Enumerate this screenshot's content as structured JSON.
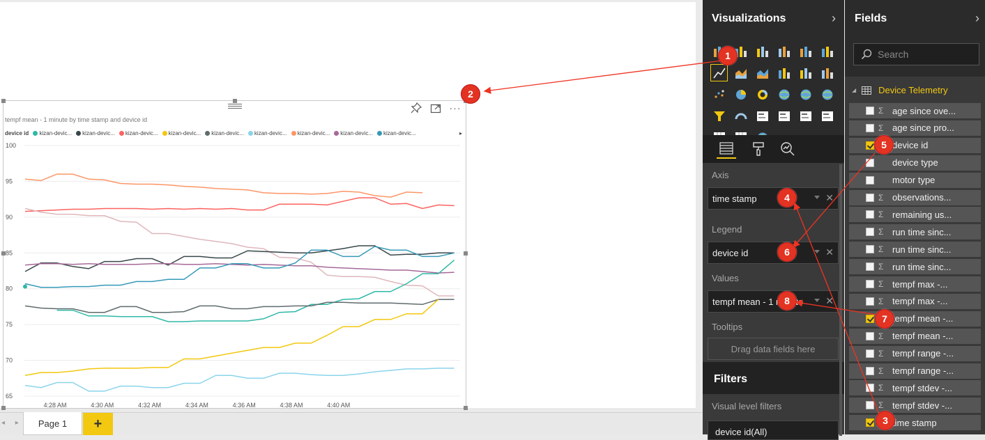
{
  "chart": {
    "title": "tempf mean - 1 minute by time stamp and device id",
    "legend_title": "device id",
    "legend_items": [
      {
        "label": "kizan-devic...",
        "color": "#2fb8a7"
      },
      {
        "label": "kizan-devic...",
        "color": "#374649"
      },
      {
        "label": "kizan-devic...",
        "color": "#fd625e"
      },
      {
        "label": "kizan-devic...",
        "color": "#f2c80f"
      },
      {
        "label": "kizan-devic...",
        "color": "#5f6b6d"
      },
      {
        "label": "kizan-devic...",
        "color": "#8ad4eb"
      },
      {
        "label": "kizan-devic...",
        "color": "#fe9666"
      },
      {
        "label": "kizan-devic...",
        "color": "#a66999"
      },
      {
        "label": "kizan-devic...",
        "color": "#3599b8"
      }
    ],
    "legend_more": "▸"
  },
  "chart_data": {
    "type": "line",
    "title": "tempf mean - 1 minute by time stamp and device id",
    "xlabel": "",
    "ylabel": "",
    "x_ticks": [
      "4:28 AM",
      "4:30 AM",
      "4:32 AM",
      "4:34 AM",
      "4:36 AM",
      "4:38 AM",
      "4:40 AM"
    ],
    "ylim": [
      65,
      100
    ],
    "y_ticks": [
      65,
      70,
      75,
      80,
      85,
      90,
      95,
      100
    ],
    "grid": true,
    "series": [
      {
        "color": "#fe9666",
        "values": [
          95.3,
          95.1,
          96.0,
          96.0,
          95.3,
          95.2,
          94.7,
          94.6,
          94.6,
          94.5,
          94.3,
          94.2,
          94.0,
          93.9,
          93.8,
          93.4,
          93.3,
          93.3,
          93.2,
          93.3,
          93.6,
          93.5,
          93.0,
          92.8,
          93.5,
          93.4,
          null,
          null
        ]
      },
      {
        "color": "#fd625e",
        "values": [
          90.8,
          90.9,
          91.0,
          91.1,
          91.1,
          91.2,
          91.2,
          91.2,
          91.1,
          91.2,
          91.1,
          91.2,
          91.1,
          91.2,
          91.0,
          91.0,
          91.8,
          91.8,
          91.8,
          91.7,
          92.2,
          92.7,
          92.7,
          91.8,
          91.9,
          91.2,
          91.7,
          91.6
        ]
      },
      {
        "color": "#dfb7bc",
        "values": [
          91.2,
          90.7,
          90.4,
          90.4,
          90.2,
          90.2,
          89.4,
          89.3,
          87.7,
          87.7,
          87.3,
          86.9,
          86.6,
          86.3,
          85.8,
          85.6,
          84.4,
          84.3,
          83.7,
          81.9,
          81.7,
          81.7,
          81.6,
          81.0,
          80.5,
          80.4,
          79.0,
          79.0
        ]
      },
      {
        "color": "#374649",
        "values": [
          82.4,
          83.6,
          83.6,
          83.1,
          82.8,
          83.8,
          83.8,
          84.2,
          84.2,
          83.3,
          84.5,
          84.5,
          84.3,
          84.3,
          85.3,
          85.2,
          85.1,
          85.0,
          85.0,
          85.3,
          85.6,
          86.0,
          86.0,
          84.7,
          84.8,
          84.8,
          85.0,
          85.0
        ]
      },
      {
        "color": "#a66999",
        "values": [
          83.3,
          83.5,
          83.5,
          83.4,
          83.5,
          83.4,
          83.4,
          83.4,
          83.5,
          83.5,
          83.4,
          83.4,
          83.5,
          83.4,
          83.3,
          83.4,
          83.3,
          83.2,
          83.2,
          83.0,
          82.9,
          82.8,
          82.7,
          82.6,
          82.6,
          82.4,
          82.2,
          82.3
        ]
      },
      {
        "color": "#3599b8",
        "values": [
          80.7,
          80.2,
          80.2,
          80.3,
          80.3,
          80.5,
          80.5,
          81.0,
          81.0,
          81.3,
          81.3,
          82.9,
          82.9,
          83.5,
          83.5,
          82.9,
          82.9,
          83.6,
          85.4,
          85.4,
          84.5,
          84.5,
          85.9,
          85.4,
          85.4,
          84.5,
          84.5,
          85.0
        ]
      },
      {
        "color": "#2fb8a7",
        "values": [
          80.3,
          null,
          77.0,
          77.0,
          76.2,
          76.2,
          76.1,
          76.1,
          76.1,
          75.4,
          75.4,
          75.5,
          75.5,
          75.5,
          75.5,
          75.8,
          76.7,
          76.8,
          77.8,
          77.8,
          78.5,
          78.6,
          79.6,
          79.6,
          80.7,
          82.1,
          82.1,
          84.0
        ]
      },
      {
        "color": "#5f6b6d",
        "values": [
          77.6,
          77.3,
          77.2,
          77.2,
          76.7,
          76.7,
          77.5,
          77.5,
          76.7,
          76.7,
          76.8,
          77.6,
          77.6,
          77.2,
          77.2,
          77.5,
          77.5,
          77.6,
          77.6,
          78.1,
          78.1,
          78.0,
          78.0,
          78.0,
          77.9,
          77.8,
          78.5,
          78.5
        ]
      },
      {
        "color": "#f2c80f",
        "values": [
          67.9,
          68.3,
          68.3,
          68.5,
          68.8,
          68.9,
          68.9,
          68.9,
          69.0,
          69.0,
          70.2,
          70.2,
          70.6,
          71.0,
          71.4,
          71.8,
          71.8,
          72.4,
          72.4,
          73.5,
          74.7,
          74.7,
          75.7,
          75.7,
          76.5,
          76.5,
          78.5,
          null
        ]
      },
      {
        "color": "#8ad4eb",
        "values": [
          66.5,
          66.2,
          66.9,
          66.9,
          65.7,
          65.7,
          66.4,
          66.4,
          66.2,
          66.2,
          66.8,
          66.8,
          67.9,
          67.9,
          67.5,
          67.5,
          68.2,
          68.2,
          68.0,
          67.9,
          67.9,
          68.1,
          68.4,
          68.6,
          68.8,
          68.8,
          68.9,
          68.9
        ]
      }
    ]
  },
  "tabs": {
    "page1": "Page 1",
    "add": "+",
    "nav_arrows": "◂ ▸"
  },
  "visualizations": {
    "title": "Visualizations",
    "collapse": "›",
    "icons": [
      "stacked-bar-icon",
      "stacked-column-icon",
      "clustered-bar-icon",
      "clustered-column-icon",
      "100-bar-icon",
      "100-column-icon",
      "line-chart-icon",
      "area-chart-icon",
      "stacked-area-icon",
      "line-column-icon",
      "line-clustered-column-icon",
      "waterfall-icon",
      "scatter-icon",
      "pie-icon",
      "donut-icon",
      "treemap-icon",
      "map-icon",
      "filled-map-icon",
      "funnel-icon",
      "gauge-icon",
      "card-icon",
      "multirow-card-icon",
      "kpi-icon",
      "slicer-icon",
      "table-icon",
      "matrix-icon",
      "globe-icon",
      "more-icon"
    ],
    "more_label": "···",
    "wells": {
      "axis_label": "Axis",
      "axis_value": "time stamp",
      "legend_label": "Legend",
      "legend_value": "device id",
      "values_label": "Values",
      "values_value": "tempf mean - 1 minute",
      "tooltips_label": "Tooltips",
      "tooltips_placeholder": "Drag data fields here"
    },
    "filters_title": "Filters",
    "filters_sub": "Visual level filters",
    "filter_card": "device id(All)"
  },
  "fields": {
    "title": "Fields",
    "collapse": "›",
    "search_placeholder": "Search",
    "table_name": "Device Telemetry",
    "items": [
      {
        "name": "age since ove...",
        "sigma": true,
        "checked": false
      },
      {
        "name": "age since pro...",
        "sigma": true,
        "checked": false
      },
      {
        "name": "device id",
        "sigma": false,
        "checked": true
      },
      {
        "name": "device type",
        "sigma": false,
        "checked": false
      },
      {
        "name": "motor type",
        "sigma": false,
        "checked": false
      },
      {
        "name": "observations...",
        "sigma": true,
        "checked": false
      },
      {
        "name": "remaining us...",
        "sigma": true,
        "checked": false
      },
      {
        "name": "run time sinc...",
        "sigma": true,
        "checked": false
      },
      {
        "name": "run time sinc...",
        "sigma": true,
        "checked": false
      },
      {
        "name": "run time sinc...",
        "sigma": true,
        "checked": false
      },
      {
        "name": "tempf max -...",
        "sigma": true,
        "checked": false
      },
      {
        "name": "tempf max -...",
        "sigma": true,
        "checked": false
      },
      {
        "name": "tempf mean -...",
        "sigma": true,
        "checked": true
      },
      {
        "name": "tempf mean -...",
        "sigma": true,
        "checked": false
      },
      {
        "name": "tempf range -...",
        "sigma": true,
        "checked": false
      },
      {
        "name": "tempf range -...",
        "sigma": true,
        "checked": false
      },
      {
        "name": "tempf stdev -...",
        "sigma": true,
        "checked": false
      },
      {
        "name": "tempf stdev -...",
        "sigma": true,
        "checked": false
      },
      {
        "name": "time stamp",
        "sigma": false,
        "checked": true
      }
    ]
  },
  "annotations": {
    "badge_color": "#e33322",
    "badges": [
      "1",
      "2",
      "3",
      "4",
      "5",
      "6",
      "7",
      "8"
    ]
  }
}
